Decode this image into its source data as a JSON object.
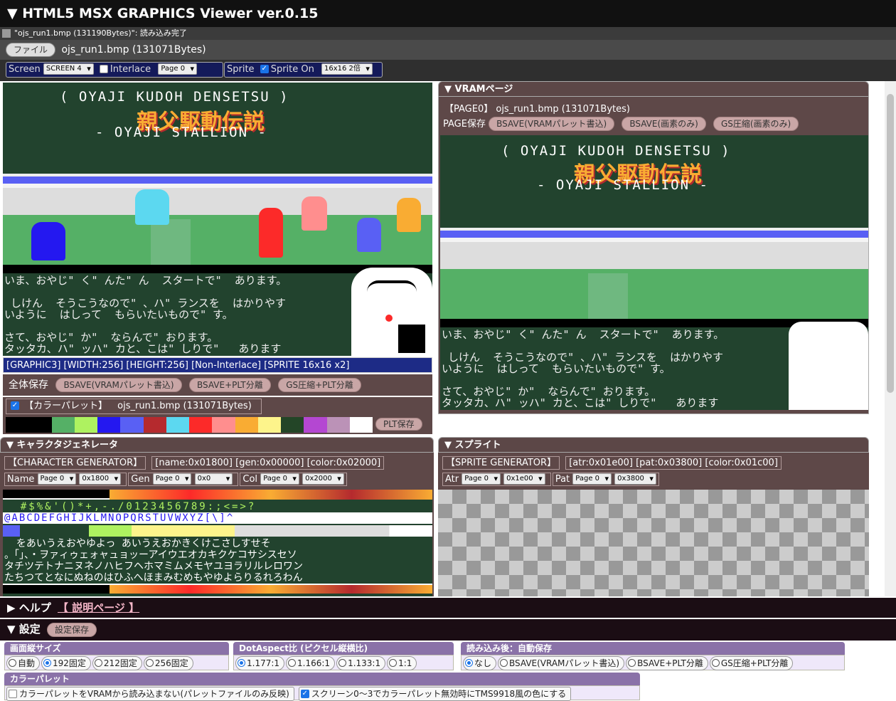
{
  "app": {
    "title": "▼ HTML5 MSX GRAPHICS Viewer ver.0.15"
  },
  "status": {
    "message": "\"ojs_run1.bmp (131190Bytes)\": 読み込み完了"
  },
  "file": {
    "button": "ファイル",
    "name": "ojs_run1.bmp (131071Bytes)"
  },
  "controls": {
    "screen_label": "Screen",
    "screen_value": "SCREEN 4",
    "interlace_label": "Interlace",
    "page_value": "Page 0",
    "sprite_label": "Sprite",
    "sprite_on_label": "Sprite On",
    "sprite_size": "16x16 2倍"
  },
  "game": {
    "title_line1": "( OYAJI KUDOH DENSETSU )",
    "title_jp": "親父駆動伝説",
    "title_line2": "- OYAJI STALLION -",
    "dialog": [
      "いま、おやじ\" く\" んた\" ん  スタートで\"  あります。",
      "",
      " しけん  そうこうなので\" 、ハ\" ランスを  はかりやす",
      "いように  はしって  もらいたいもので\" す。",
      "",
      "さて、おやじ\" か\"  ならんで\" おります。",
      "タッタカ、ハ\" ッハ\" カと、こは\" しりで\"   あります"
    ]
  },
  "info": {
    "mode": "[GRAPHIC3] [WIDTH:256] [HEIGHT:256] [Non-Interlace] [SPRITE 16x16 x2]"
  },
  "save_all": {
    "label": "全体保存",
    "b1": "BSAVE(VRAMパレット書込)",
    "b2": "BSAVE+PLT分離",
    "b3": "GS圧縮+PLT分離"
  },
  "palette": {
    "label": "【カラーパレット】",
    "file": "ojs_run1.bmp (131071Bytes)",
    "save": "PLT保存",
    "colors": [
      "#000000",
      "#000000",
      "#55b066",
      "#aef260",
      "#2418f0",
      "#5960f4",
      "#b52a2e",
      "#5cd8f0",
      "#fc2a29",
      "#ff8e8e",
      "#f9ac33",
      "#fdf48b",
      "#234527",
      "#b447d2",
      "#bb92b7",
      "#ffffff"
    ]
  },
  "vram": {
    "header": "▼ VRAMページ",
    "page_label": "【PAGE0】 ojs_run1.bmp (131071Bytes)",
    "save_label": "PAGE保存",
    "b1": "BSAVE(VRAMパレット書込)",
    "b2": "BSAVE(画素のみ)",
    "b3": "GS圧縮(画素のみ)"
  },
  "chargen": {
    "header": "▼ キャラクタジェネレータ",
    "info_label": "【CHARACTER GENERATOR】",
    "info": "[name:0x01800] [gen:0x00000] [color:0x02000]",
    "name_label": "Name",
    "name_page": "Page 0",
    "name_addr": "0x1800",
    "gen_label": "Gen",
    "gen_page": "Page 0",
    "gen_addr": "0x0",
    "col_label": "Col",
    "col_page": "Page 0",
    "col_addr": "0x2000",
    "rows": [
      "  #$%&'()*+,-./0123456789:;<=>?",
      "@ABCDEFGHIJKLMNOPQRSTUVWXYZ[\\]^",
      "",
      "  をあいうえおやゆよっ あいうえおかきくけこさしすせそ",
      "。「」、・ヲァィゥェォャュョッーアイウエオカキクケコサシスセソ",
      "タチツテトナニヌネノハヒフヘホマミムメモヤユヨラリルレロワン",
      "たちつてとなにぬねのはひふへほまみむめもやゆよらりるれろわん"
    ]
  },
  "sprite": {
    "header": "▼ スプライト",
    "info_label": "【SPRITE GENERATOR】",
    "info": "[atr:0x01e00] [pat:0x03800] [color:0x01c00]",
    "atr_label": "Atr",
    "atr_page": "Page 0",
    "atr_addr": "0x1e00",
    "pat_label": "Pat",
    "pat_page": "Page 0",
    "pat_addr": "0x3800"
  },
  "help": {
    "label": "▶ ヘルプ",
    "link": "【 説明ページ 】"
  },
  "settings": {
    "label": "▼ 設定",
    "save": "設定保存",
    "height": {
      "title": "画面縦サイズ",
      "options": [
        "自動",
        "192固定",
        "212固定",
        "256固定"
      ],
      "selected": "192固定"
    },
    "aspect": {
      "title": "DotAspect比 (ピクセル縦横比)",
      "options": [
        "1.177:1",
        "1.166:1",
        "1.133:1",
        "1:1"
      ],
      "selected": "1.177:1"
    },
    "autosave": {
      "title": "読み込み後：自動保存",
      "options": [
        "なし",
        "BSAVE(VRAMパレット書込)",
        "BSAVE+PLT分離",
        "GS圧縮+PLT分離"
      ],
      "selected": "なし"
    },
    "palette_title": "カラーパレット",
    "palette_opt1": "カラーパレットをVRAMから読み込まない(パレットファイルのみ反映)",
    "palette_opt2": "スクリーン0～3でカラーパレット無効時にTMS9918風の色にする"
  }
}
